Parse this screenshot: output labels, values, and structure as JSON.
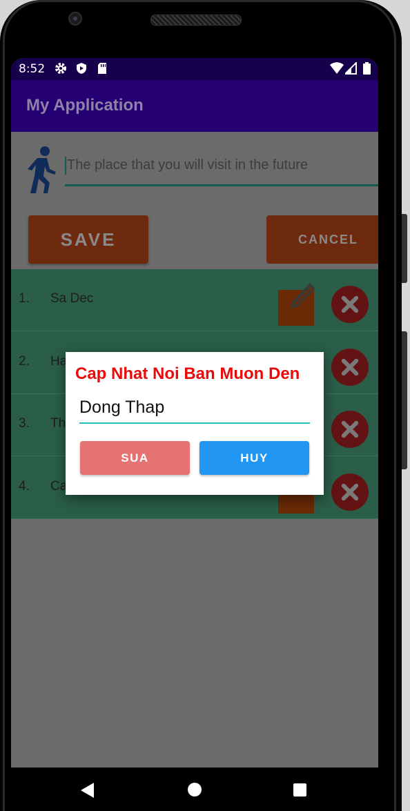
{
  "status_bar": {
    "time": "8:52",
    "left_icons": [
      "gear-icon",
      "shield-play-icon",
      "sd-card-icon"
    ],
    "right_icons": [
      "wifi-icon",
      "signal-icon",
      "battery-icon"
    ]
  },
  "app_bar": {
    "title": "My Application",
    "color": "#3f00c8"
  },
  "form": {
    "place_placeholder": "The place that you will visit in the future",
    "save_label": "SAVE",
    "cancel_label": "CANCEL",
    "icon": "walking-person-icon"
  },
  "list": {
    "items": [
      {
        "index": "1.",
        "name": "Sa Dec"
      },
      {
        "index": "2.",
        "name": "Ha"
      },
      {
        "index": "3.",
        "name": "Th"
      },
      {
        "index": "4.",
        "name": "Can Tho"
      }
    ],
    "row_color": "#4caf85"
  },
  "dialog": {
    "title": "Cap Nhat Noi Ban Muon Den",
    "input_value": "Dong Thap",
    "confirm_label": "SUA",
    "cancel_label": "HUY",
    "title_color": "#e80b0b",
    "confirm_color": "#e57373",
    "cancel_color": "#2196f3"
  },
  "nav_bar": {
    "icons": [
      "back-icon",
      "home-icon",
      "recents-icon"
    ]
  }
}
